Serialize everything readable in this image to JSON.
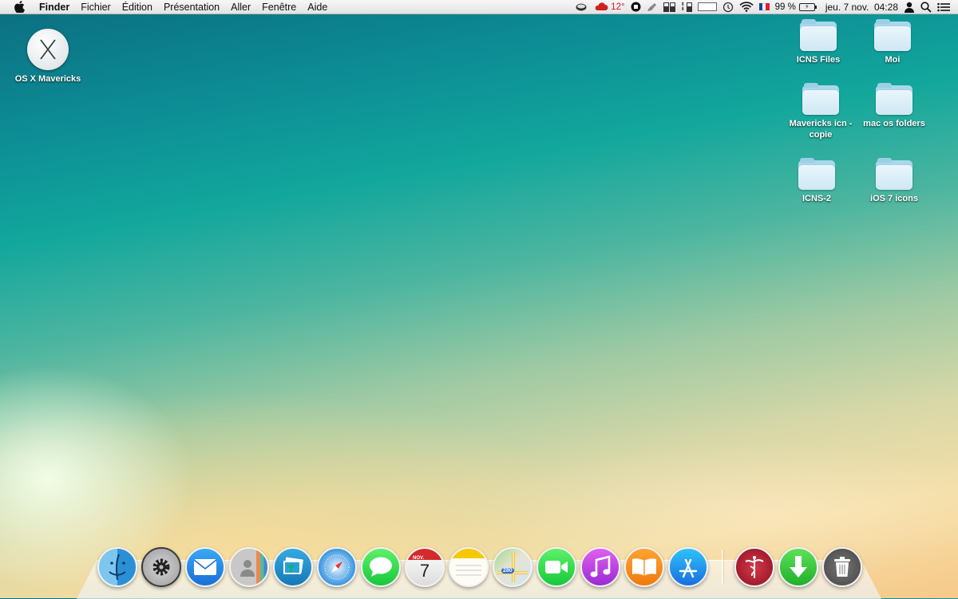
{
  "menubar": {
    "app_name": "Finder",
    "menus": [
      "Fichier",
      "Édition",
      "Présentation",
      "Aller",
      "Fenêtre",
      "Aide"
    ],
    "temperature": "12°",
    "battery_percent": "99 %",
    "clock": "jeu. 7 nov.  04:28",
    "icons": [
      "apple-logo",
      "coffee-cup",
      "weather",
      "stop",
      "pen",
      "cpu",
      "network",
      "memory",
      "time-machine",
      "wifi",
      "flag-france",
      "battery",
      "user",
      "spotlight",
      "notification-center"
    ]
  },
  "desktop": {
    "items": [
      {
        "label": "OS X Mavericks",
        "type": "disk"
      },
      {
        "label": "ICNS Files",
        "type": "folder"
      },
      {
        "label": "Moi",
        "type": "folder"
      },
      {
        "label": "Mavericks icn - copie",
        "type": "folder"
      },
      {
        "label": "mac os folders",
        "type": "folder"
      },
      {
        "label": "ICNS-2",
        "type": "folder"
      },
      {
        "label": "iOS 7 icons",
        "type": "folder"
      }
    ]
  },
  "dock": {
    "apps": [
      "finder",
      "system-preferences",
      "mail",
      "contacts",
      "iphoto",
      "safari",
      "messages",
      "calendar",
      "notes",
      "maps",
      "facetime",
      "itunes",
      "ibooks",
      "app-store"
    ],
    "calendar_month": "NOV.",
    "calendar_day": "7",
    "maps_route": "280",
    "extras": [
      "disk-utility",
      "downloads",
      "trash"
    ]
  }
}
